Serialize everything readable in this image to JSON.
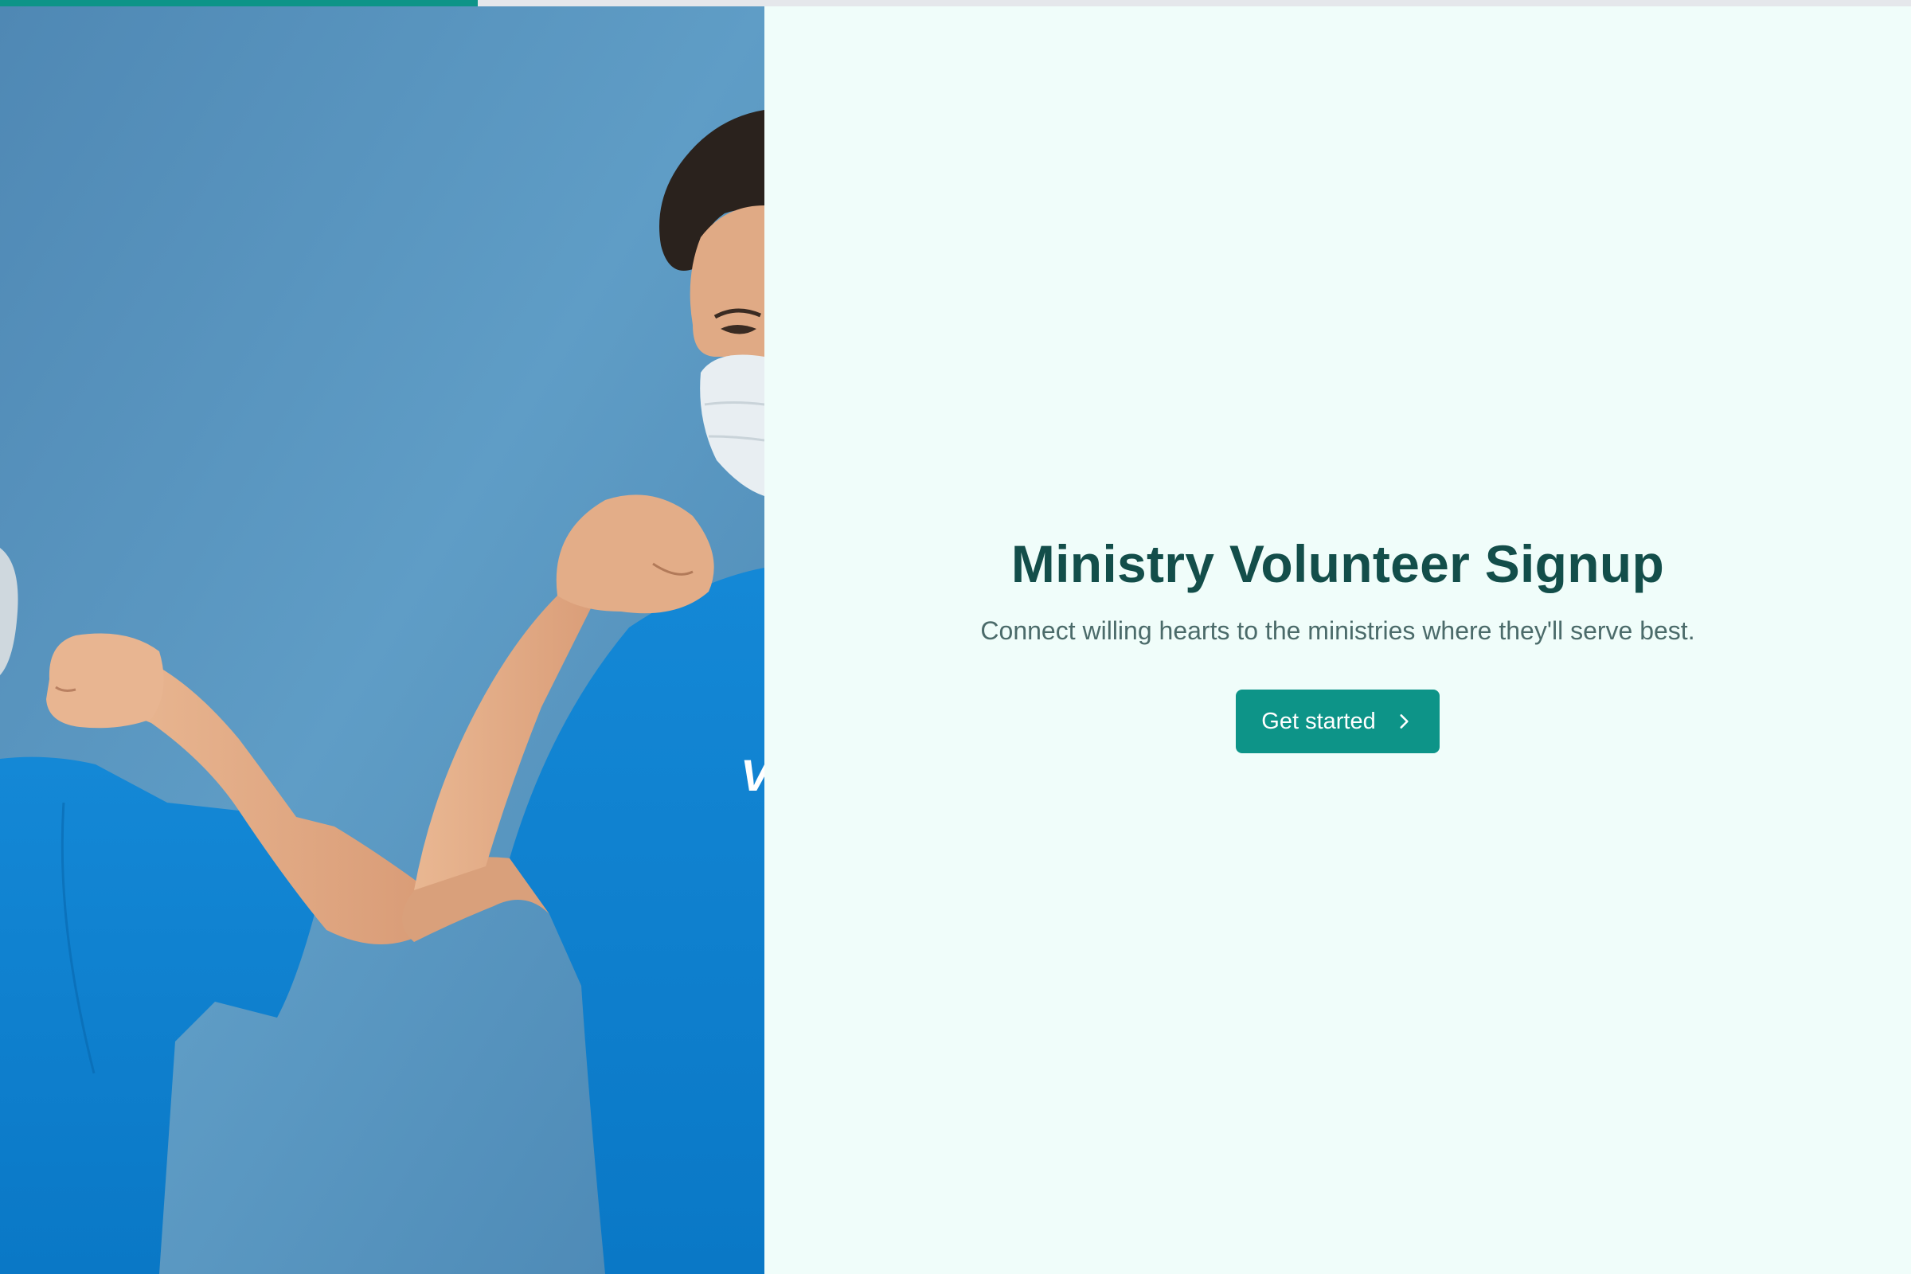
{
  "progress": {
    "value": 0.25
  },
  "hero_image": {
    "icon": "volunteers-elbow-bump-photo",
    "background_color": "#5a95bf",
    "shirt_color": "#0b7fd0",
    "shirt_text": "V"
  },
  "welcome": {
    "title": "Ministry Volunteer Signup",
    "subtitle": "Connect willing hearts to the ministries where they'll serve best.",
    "cta_label": "Get started",
    "cta_icon": "chevron-right-icon"
  },
  "colors": {
    "accent": "#0d9488",
    "title": "#134e4a",
    "subtitle": "#4b6b6a",
    "panel_bg": "#f0fdfa",
    "track": "#e5e7eb"
  }
}
